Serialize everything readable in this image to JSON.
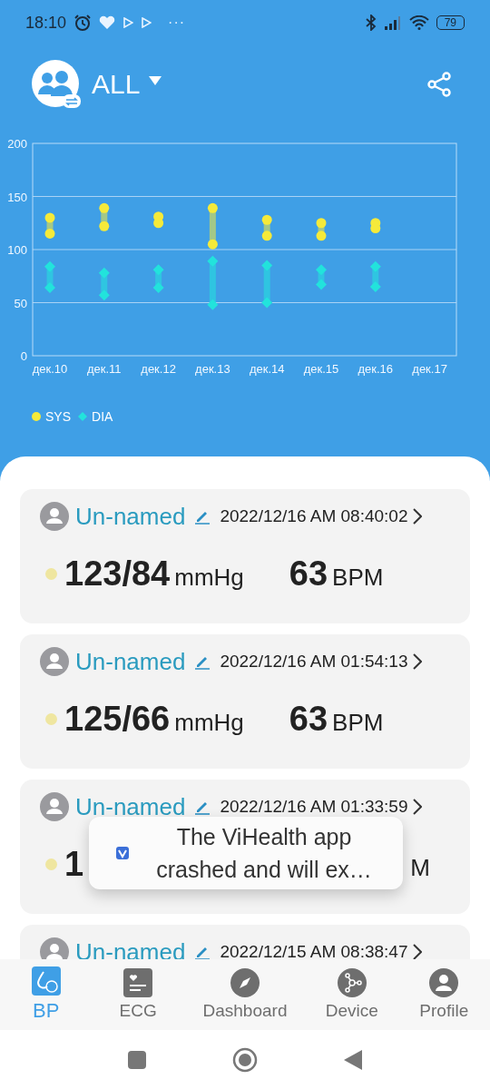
{
  "status_bar": {
    "time": "18:10",
    "more": "···",
    "battery": "79"
  },
  "header": {
    "title": "ALL"
  },
  "chart": {
    "chart_data": {
      "type": "scatter",
      "categories": [
        "дек.10",
        "дек.11",
        "дек.12",
        "дек.13",
        "дек.14",
        "дек.15",
        "дек.16",
        "дек.17"
      ],
      "ylim": [
        0,
        200
      ],
      "yticks": [
        0,
        50,
        100,
        150,
        200
      ],
      "series": [
        {
          "name": "SYS",
          "color": "#f5ea3a",
          "marker": "circle",
          "values": [
            130,
            139,
            131,
            139,
            128,
            125,
            125,
            null
          ]
        },
        {
          "color": "#f5ea3a",
          "values": [
            115,
            122,
            125,
            105,
            113,
            113,
            120,
            null
          ]
        },
        {
          "name": "DIA",
          "color": "#22e3dc",
          "marker": "diamond",
          "values": [
            84,
            78,
            81,
            89,
            85,
            81,
            84,
            null
          ]
        },
        {
          "color": "#22e3dc",
          "values": [
            64,
            57,
            64,
            48,
            50,
            67,
            65,
            null
          ]
        }
      ],
      "grid": true
    }
  },
  "records": [
    {
      "kind": "full",
      "name": "Un-named",
      "time": "2022/12/16 AM 08:40:02",
      "color": "#efe6a0",
      "pressure": "123/84",
      "pressure_unit": "mmHg",
      "pulse": "63",
      "pulse_unit": "BPM"
    },
    {
      "kind": "full",
      "name": "Un-named",
      "time": "2022/12/16 AM 01:54:13",
      "color": "#efe6a0",
      "pressure": "125/66",
      "pressure_unit": "mmHg",
      "pulse": "63",
      "pulse_unit": "BPM"
    },
    {
      "kind": "covered",
      "name": "Un-named",
      "time": "2022/12/16 AM 01:33:59",
      "color": "#efe6a0",
      "pressure": "1",
      "pulse_unit": "M"
    },
    {
      "kind": "cut",
      "name": "Un-named",
      "time": "2022/12/15 AM 08:38:47"
    }
  ],
  "toast": {
    "message": "The ViHealth app crashed and will ex…"
  },
  "bottom_nav": [
    {
      "label": "BP",
      "selected": true
    },
    {
      "label": "ECG",
      "selected": false
    },
    {
      "label": "Dashboard",
      "selected": false
    },
    {
      "label": "Device",
      "selected": false
    },
    {
      "label": "Profile",
      "selected": false
    }
  ]
}
